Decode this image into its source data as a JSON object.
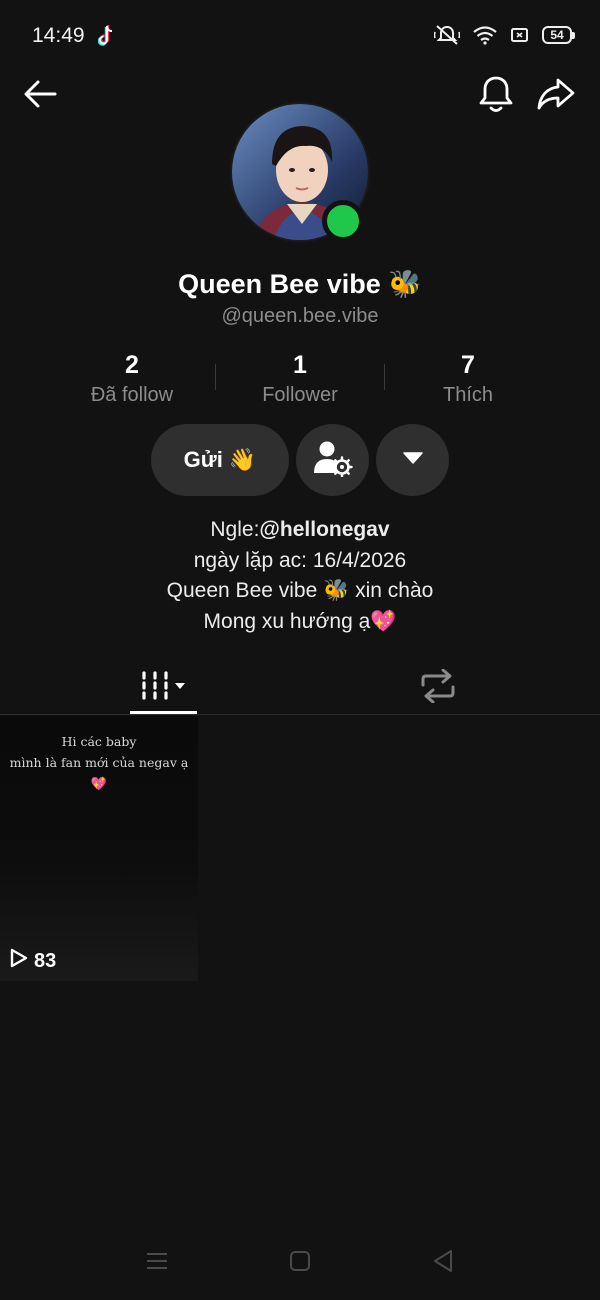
{
  "status_bar": {
    "time": "14:49",
    "battery": "54",
    "icons": [
      "tiktok-icon",
      "mute-icon",
      "wifi-icon",
      "sim-icon",
      "battery-icon"
    ]
  },
  "nav": {
    "back_icon": "back-arrow-icon",
    "bell_icon": "bell-icon",
    "share_icon": "share-icon"
  },
  "profile": {
    "name": "Queen Bee vibe 🐝",
    "handle": "@queen.bee.vibe",
    "online": true,
    "online_color": "#1ec84a"
  },
  "stats": [
    {
      "value": "2",
      "label": "Đã follow"
    },
    {
      "value": "1",
      "label": "Follower"
    },
    {
      "value": "7",
      "label": "Thích"
    }
  ],
  "actions": {
    "send_label": "Gửi 👋",
    "manage_icon": "user-settings-icon",
    "more_icon": "caret-down-icon"
  },
  "bio": {
    "line1_prefix": "Ngle:",
    "line1_mention": "@hellonegav",
    "line2": "ngày lặp ac: 16/4/2026",
    "line3": "Queen Bee vibe 🐝 xin chào",
    "line4": "Mong xu hướng ạ💖"
  },
  "tabs": [
    {
      "icon": "videos-grid-icon",
      "active": true
    },
    {
      "icon": "repost-icon",
      "active": false
    }
  ],
  "videos": [
    {
      "caption_line1": "Hi các baby",
      "caption_line2": "mình là fan mới của negav ạ",
      "caption_emoji": "💖",
      "views": "83"
    }
  ],
  "system_nav": [
    "menu-icon",
    "home-icon",
    "back-triangle-icon"
  ]
}
